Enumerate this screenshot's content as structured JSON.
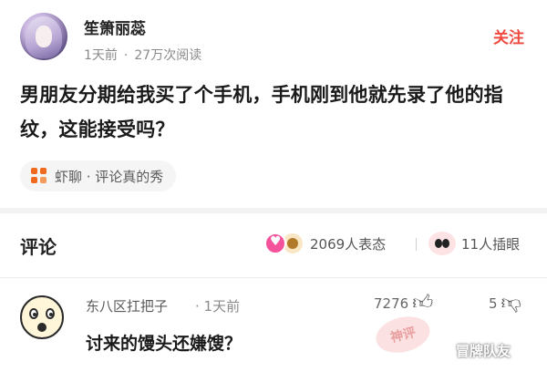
{
  "post": {
    "username": "笙箫丽蕊",
    "time": "1天前",
    "views": "27万次阅读",
    "follow_label": "关注",
    "text": "男朋友分期给我买了个手机，手机刚到他就先录了他的指纹，这能接受吗？",
    "topic": "虾聊 · 评论真的秀"
  },
  "comments_section": {
    "title": "评论",
    "reactions_label": "2069人表态",
    "peek_label": "11人插眼"
  },
  "comment": {
    "username": "东八区扛把子",
    "time": "· 1天前",
    "likes": "7276",
    "dislikes": "5",
    "text": "讨来的馒头还嫌馊？",
    "badge": "神评"
  },
  "watermark": "冒牌队友",
  "icons": {
    "topic": "topic-grid-icon",
    "heart": "heart-reaction-icon",
    "thumb": "thumbs-up-icon",
    "dislike": "thumbs-down-icon",
    "peek": "peek-eyes-icon"
  },
  "colors": {
    "accent": "#f0483e",
    "topic_icon": "#f06a1d",
    "heart": "#f4529b"
  }
}
